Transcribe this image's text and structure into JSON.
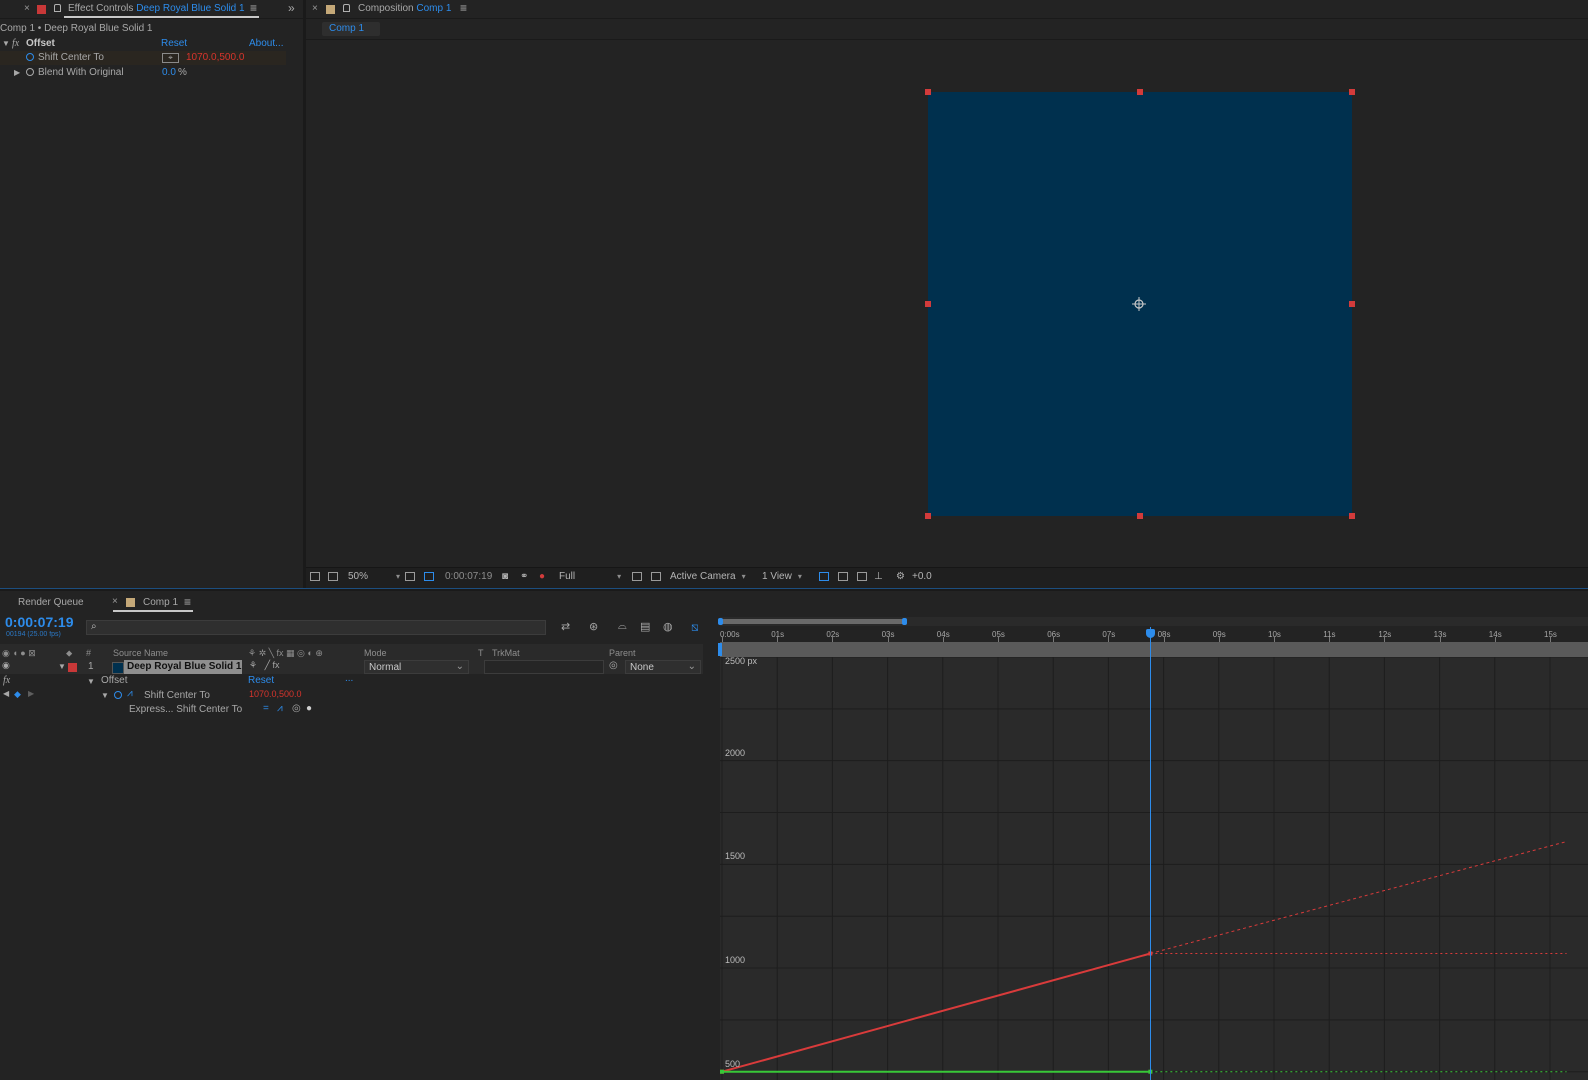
{
  "effect_controls": {
    "tab_prefix": "Effect Controls",
    "tab_layer": "Deep Royal Blue Solid 1",
    "breadcrumb": "Comp 1 • Deep Royal Blue Solid 1",
    "effect_name": "Offset",
    "fx_label": "fx",
    "reset_label": "Reset",
    "about_label": "About...",
    "props": [
      {
        "name": "Shift Center To",
        "value": "1070.0,500.0"
      },
      {
        "name": "Blend With Original",
        "value": "0.0",
        "unit": "%"
      }
    ]
  },
  "composition": {
    "tab_prefix": "Composition",
    "tab_comp": "Comp 1",
    "subtab": "Comp 1",
    "solid_color": "#00304e",
    "handle_color": "#d23b3b"
  },
  "viewer_toolbar": {
    "zoom": "50%",
    "timecode": "0:00:07:19",
    "resolution": "Full",
    "camera": "Active Camera",
    "views": "1 View",
    "exposure": "+0.0"
  },
  "timeline": {
    "render_queue_tab": "Render Queue",
    "comp_tab": "Comp 1",
    "current_time": "0:00:07:19",
    "frame_info": "00194 (25.00 fps)",
    "search_icon": "search-icon",
    "columns": {
      "num": "#",
      "source_name": "Source Name",
      "mode": "Mode",
      "t": "T",
      "trkmat": "TrkMat",
      "parent": "Parent"
    },
    "layer": {
      "index": "1",
      "name": "Deep Royal Blue Solid 1",
      "mode": "Normal",
      "parent": "None",
      "label_color": "#c83838"
    },
    "effect_row": {
      "fx": "fx",
      "name": "Offset",
      "reset": "Reset",
      "more": "..."
    },
    "prop_row": {
      "name": "Shift Center To",
      "value": "1070.0,500.0"
    },
    "expr_row": {
      "name": "Express... Shift Center To"
    },
    "ruler_labels": [
      "0:00s",
      "01s",
      "02s",
      "03s",
      "04s",
      "05s",
      "06s",
      "07s",
      "08s",
      "09s",
      "10s",
      "11s",
      "12s",
      "13s",
      "14s",
      "15s"
    ],
    "graph_top_label": "2500 px",
    "graph_y_labels": [
      "2000",
      "1500",
      "1000",
      "500"
    ]
  },
  "chart_data": {
    "type": "line",
    "x_unit": "seconds",
    "xlim": [
      0,
      15.3
    ],
    "ylim": [
      460,
      2500
    ],
    "current_time": 7.76,
    "series": [
      {
        "color": "#d93b3b",
        "style": "solid",
        "points": [
          [
            0,
            500
          ],
          [
            7.76,
            1070
          ]
        ]
      },
      {
        "color": "#d93b3b",
        "style": "dashed",
        "points": [
          [
            7.76,
            1070
          ],
          [
            15.3,
            1610
          ]
        ]
      },
      {
        "color": "#d93b3b",
        "style": "dotted",
        "points": [
          [
            7.76,
            1070
          ],
          [
            15.3,
            1070
          ]
        ]
      },
      {
        "color": "#38c838",
        "style": "solid",
        "points": [
          [
            0,
            500
          ],
          [
            7.76,
            500
          ]
        ]
      },
      {
        "color": "#38c838",
        "style": "dotted",
        "points": [
          [
            7.76,
            500
          ],
          [
            15.3,
            500
          ]
        ]
      }
    ]
  }
}
